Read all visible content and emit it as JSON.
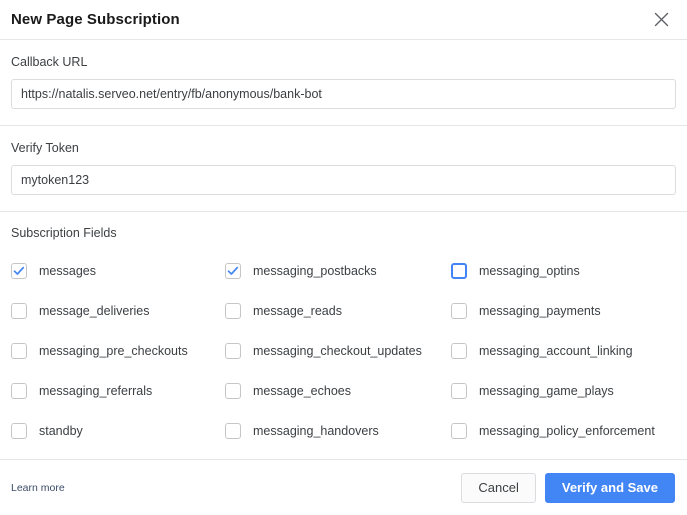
{
  "dialog": {
    "title": "New Page Subscription",
    "close_icon": "close-icon"
  },
  "callback": {
    "label": "Callback URL",
    "value": "https://natalis.serveo.net/entry/fb/anonymous/bank-bot",
    "placeholder": "Callback URL"
  },
  "verify_token": {
    "label": "Verify Token",
    "value": "mytoken123",
    "placeholder": "Verify Token"
  },
  "subscription_fields": {
    "label": "Subscription Fields",
    "items": [
      {
        "name": "messages",
        "checked": true,
        "focused": false
      },
      {
        "name": "messaging_postbacks",
        "checked": true,
        "focused": false
      },
      {
        "name": "messaging_optins",
        "checked": false,
        "focused": true
      },
      {
        "name": "message_deliveries",
        "checked": false,
        "focused": false
      },
      {
        "name": "message_reads",
        "checked": false,
        "focused": false
      },
      {
        "name": "messaging_payments",
        "checked": false,
        "focused": false
      },
      {
        "name": "messaging_pre_checkouts",
        "checked": false,
        "focused": false
      },
      {
        "name": "messaging_checkout_updates",
        "checked": false,
        "focused": false
      },
      {
        "name": "messaging_account_linking",
        "checked": false,
        "focused": false
      },
      {
        "name": "messaging_referrals",
        "checked": false,
        "focused": false
      },
      {
        "name": "message_echoes",
        "checked": false,
        "focused": false
      },
      {
        "name": "messaging_game_plays",
        "checked": false,
        "focused": false
      },
      {
        "name": "standby",
        "checked": false,
        "focused": false
      },
      {
        "name": "messaging_handovers",
        "checked": false,
        "focused": false
      },
      {
        "name": "messaging_policy_enforcement",
        "checked": false,
        "focused": false
      }
    ]
  },
  "footer": {
    "learn_more_label": "Learn more",
    "cancel_label": "Cancel",
    "primary_label": "Verify and Save"
  },
  "colors": {
    "accent": "#4285f4",
    "border": "#dcdcdc",
    "divider": "#e6e6e6",
    "text": "#3c4043",
    "title": "#1a1a1a",
    "link": "#3b4a68"
  }
}
